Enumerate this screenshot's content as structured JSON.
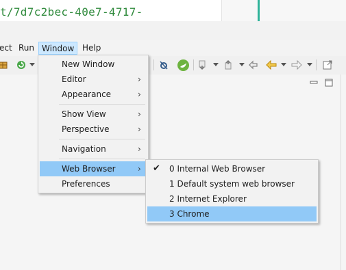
{
  "editor_snippet": "t/7d7c2bec-40e7-4717-",
  "menubar": {
    "items": [
      "ect",
      "Run",
      "Window",
      "Help"
    ],
    "active": "Window"
  },
  "window_menu": {
    "items": [
      {
        "label": "New Window",
        "submenu": false
      },
      {
        "label": "Editor",
        "submenu": true
      },
      {
        "label": "Appearance",
        "submenu": true
      },
      {
        "label": "Show View",
        "submenu": true
      },
      {
        "label": "Perspective",
        "submenu": true
      },
      {
        "label": "Navigation",
        "submenu": true
      },
      {
        "label": "Web Browser",
        "submenu": true,
        "highlighted": true
      },
      {
        "label": "Preferences",
        "submenu": false
      }
    ],
    "arrow_glyph": "›"
  },
  "browser_menu": {
    "items": [
      {
        "label": "0 Internal Web Browser",
        "checked": true
      },
      {
        "label": "1 Default system web browser"
      },
      {
        "label": "2 Internet Explorer"
      },
      {
        "label": "3 Chrome",
        "highlighted": true
      }
    ],
    "check_glyph": "✔"
  },
  "colors": {
    "highlight": "#91c9f7",
    "menubar_active": "#cce8ff",
    "code_text": "#2f8a3c"
  }
}
